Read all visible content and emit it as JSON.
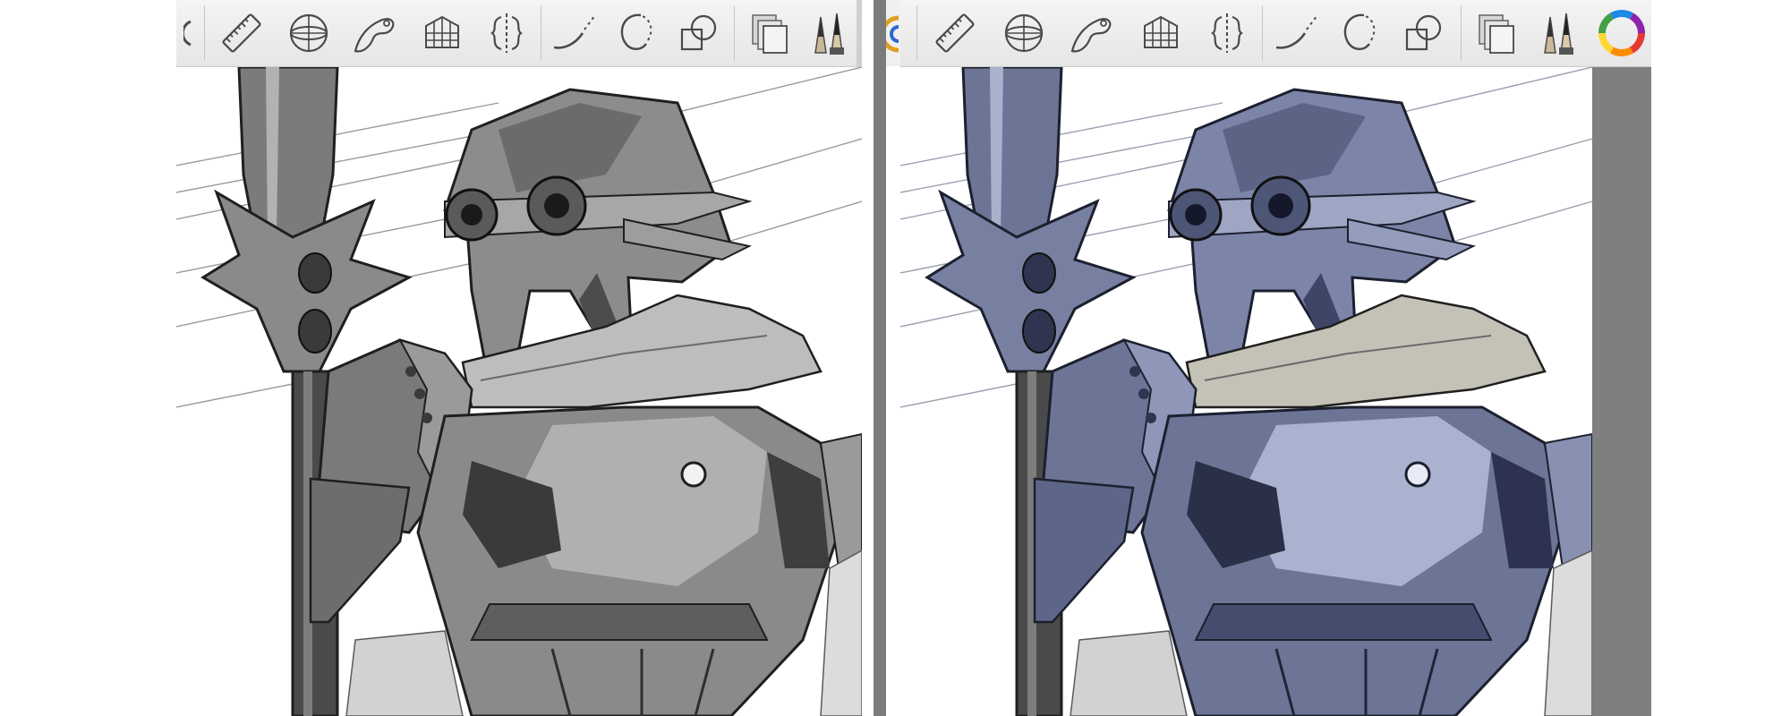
{
  "screenshot": {
    "panels": [
      {
        "id": "grayscale",
        "tool_icons": [
          "ruler-icon",
          "ellipse-guide-icon",
          "french-curve-icon",
          "perspective-grid-icon",
          "symmetry-icon",
          "line-stroke-icon",
          "ellipse-stroke-icon",
          "shape-icon",
          "layers-icon",
          "brush-library-icon"
        ],
        "palette": {
          "armor_dark": "#3a3a3a",
          "armor_mid": "#7a7a7a",
          "armor_light": "#bcbcbc",
          "line": "#1f1f1f"
        }
      },
      {
        "id": "tinted",
        "tool_icons": [
          "ruler-icon",
          "ellipse-guide-icon",
          "french-curve-icon",
          "perspective-grid-icon",
          "symmetry-icon",
          "line-stroke-icon",
          "ellipse-stroke-icon",
          "shape-icon",
          "layers-icon",
          "brush-library-icon",
          "color-wheel-icon"
        ],
        "palette": {
          "armor_dark": "#2f3550",
          "armor_mid": "#6c7596",
          "armor_light": "#b7bdd4",
          "line": "#1c1f2e"
        }
      }
    ],
    "colors": {
      "toolbar_bg": "#eeeeee",
      "divider": "#7b7b7b",
      "gutter": "#7f7f7f",
      "icon_stroke": "#4a4a4a"
    }
  }
}
